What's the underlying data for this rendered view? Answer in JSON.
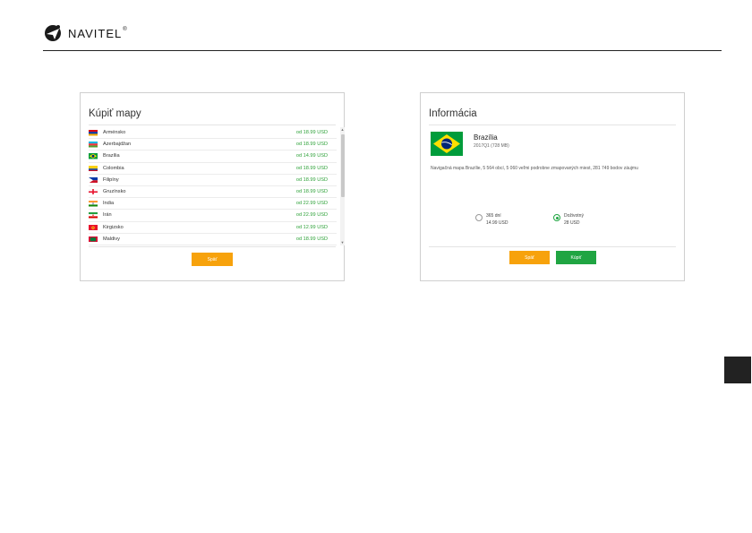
{
  "header": {
    "brand": "NAVITEL",
    "brand_mark": "®"
  },
  "buy_maps": {
    "title": "Kúpiť mapy",
    "countries": [
      {
        "name": "Arménsko",
        "price": "od 18.99 USD",
        "flag": "armenia"
      },
      {
        "name": "Azerbajdžan",
        "price": "od 18.99 USD",
        "flag": "azerbaijan"
      },
      {
        "name": "Brazília",
        "price": "od 14.99 USD",
        "flag": "brazil"
      },
      {
        "name": "Colombia",
        "price": "od 18.99 USD",
        "flag": "colombia"
      },
      {
        "name": "Filipíny",
        "price": "od 18.99 USD",
        "flag": "philippines"
      },
      {
        "name": "Gruzínsko",
        "price": "od 18.99 USD",
        "flag": "georgia"
      },
      {
        "name": "India",
        "price": "od 22.99 USD",
        "flag": "india"
      },
      {
        "name": "Irán",
        "price": "od 22.99 USD",
        "flag": "iran"
      },
      {
        "name": "Kirgizsko",
        "price": "od 12.99 USD",
        "flag": "kyrgyzstan"
      },
      {
        "name": "Maldivy",
        "price": "od 18.99 USD",
        "flag": "maldives"
      }
    ],
    "back_label": "Späť"
  },
  "info": {
    "title": "Informácia",
    "map_name": "Brazília",
    "map_meta": "2017Q1 (728 MB)",
    "description": "Navigačná mapa Brazílie, 5 564 obcí, 5 060 veľmi podrobne zmapovaných miest, 281 749 bodov záujmu",
    "options": [
      {
        "label": "365 dní",
        "price": "14.99 USD",
        "selected": false
      },
      {
        "label": "Doživotný",
        "price": "28 USD",
        "selected": true
      }
    ],
    "back_label": "Späť",
    "buy_label": "Kúpiť"
  },
  "colors": {
    "accent_orange": "#f7a20c",
    "accent_green": "#20a542",
    "price_green": "#2fa23a"
  }
}
